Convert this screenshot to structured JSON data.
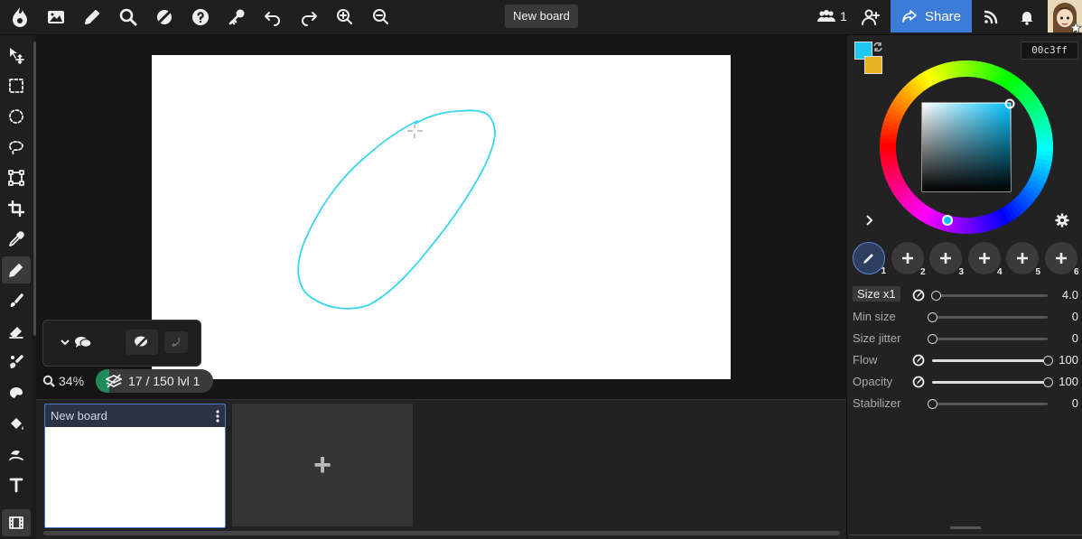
{
  "topbar": {
    "board_title": "New board",
    "users_count": "1",
    "share_label": "Share",
    "icons": [
      "app-logo-icon",
      "image-icon",
      "pencil-icon",
      "search-icon",
      "contrast-icon",
      "help-icon",
      "key-icon",
      "undo-icon",
      "redo-icon",
      "zoom-in-icon",
      "zoom-out-icon",
      "users-icon",
      "add-user-icon",
      "share-icon",
      "rss-icon",
      "bell-icon"
    ]
  },
  "tools": [
    "move",
    "rect-select",
    "ellipse-select",
    "lasso-select",
    "transform",
    "crop",
    "eyedropper",
    "pen",
    "brush",
    "eraser",
    "smudge",
    "blend",
    "fill",
    "shape",
    "text",
    "film"
  ],
  "active_tool": "pen",
  "canvas": {
    "stroke_color": "#36d6ee",
    "zoom_label": "34%",
    "layers_label": "17 / 150  lvl 1",
    "layers_fraction": 0.113
  },
  "boards": {
    "items": [
      {
        "title": "New board"
      }
    ],
    "add_label": "+"
  },
  "color": {
    "hex": "00c3ff",
    "primary": "#1fc8f0",
    "secondary": "#e6b321"
  },
  "brush_slots": [
    {
      "num": "1",
      "active": true
    },
    {
      "num": "2",
      "active": false
    },
    {
      "num": "3",
      "active": false
    },
    {
      "num": "4",
      "active": false
    },
    {
      "num": "5",
      "active": false
    },
    {
      "num": "6",
      "active": false
    }
  ],
  "brush_settings": [
    {
      "label": "Size x1",
      "value": "4.0",
      "fraction": 0.03,
      "pressure": true
    },
    {
      "label": "Min size",
      "value": "0",
      "fraction": 0.0,
      "pressure": false
    },
    {
      "label": "Size jitter",
      "value": "0",
      "fraction": 0.0,
      "pressure": false
    },
    {
      "label": "Flow",
      "value": "100",
      "fraction": 1.0,
      "pressure": true
    },
    {
      "label": "Opacity",
      "value": "100",
      "fraction": 1.0,
      "pressure": true
    },
    {
      "label": "Stabilizer",
      "value": "0",
      "fraction": 0.0,
      "pressure": false
    }
  ]
}
